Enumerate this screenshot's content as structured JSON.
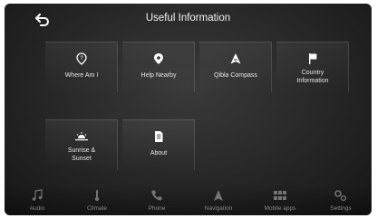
{
  "header": {
    "title": "Useful Information",
    "back_icon": "back-arrow-icon"
  },
  "tiles": [
    {
      "label": "Where Am I",
      "icon": "location-question-icon"
    },
    {
      "label": "Help Nearby",
      "icon": "help-pin-icon"
    },
    {
      "label": "Qibla Compass",
      "icon": "compass-icon"
    },
    {
      "label": "Country\nInformation",
      "icon": "flag-icon"
    },
    {
      "label": "Sunrise &\nSunset",
      "icon": "sunrise-icon"
    },
    {
      "label": "About",
      "icon": "document-icon"
    }
  ],
  "bottom_nav": [
    {
      "label": "Audio",
      "icon": "music-note-icon"
    },
    {
      "label": "Climate",
      "icon": "climate-icon"
    },
    {
      "label": "Phone",
      "icon": "phone-icon"
    },
    {
      "label": "Navigation",
      "icon": "navigation-icon"
    },
    {
      "label": "Mobile apps",
      "icon": "apps-grid-icon"
    },
    {
      "label": "Settings",
      "icon": "settings-icon"
    }
  ]
}
